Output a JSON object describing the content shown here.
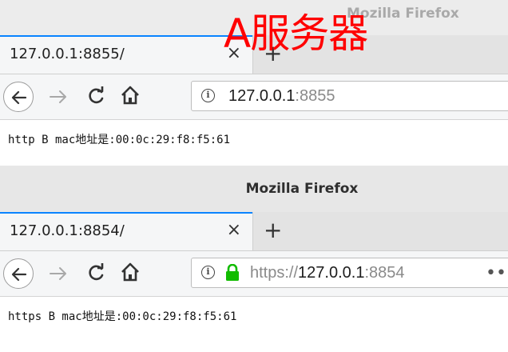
{
  "overlay_label": "A服务器",
  "windows": [
    {
      "title": "Mozilla Firefox",
      "tab_label": "127.0.0.1:8855/",
      "tab_close": "×",
      "new_tab": "+",
      "url_host": "127.0.0.1",
      "url_port": ":8855",
      "page_text": "http B mac地址是:00:0c:29:f8:f5:61"
    },
    {
      "title": "Mozilla Firefox",
      "tab_label": "127.0.0.1:8854/",
      "tab_close": "×",
      "new_tab": "+",
      "url_scheme": "https://",
      "url_host": "127.0.0.1",
      "url_port": ":8854",
      "url_more": "••",
      "page_text": "https B mac地址是:00:0c:29:f8:f5:61"
    }
  ],
  "colors": {
    "accent": "#0a84ff",
    "overlay": "#ff0000",
    "secure_lock": "#12bc00"
  },
  "icons": [
    "back-arrow-icon",
    "forward-arrow-icon",
    "reload-icon",
    "home-icon",
    "info-icon",
    "lock-icon"
  ]
}
